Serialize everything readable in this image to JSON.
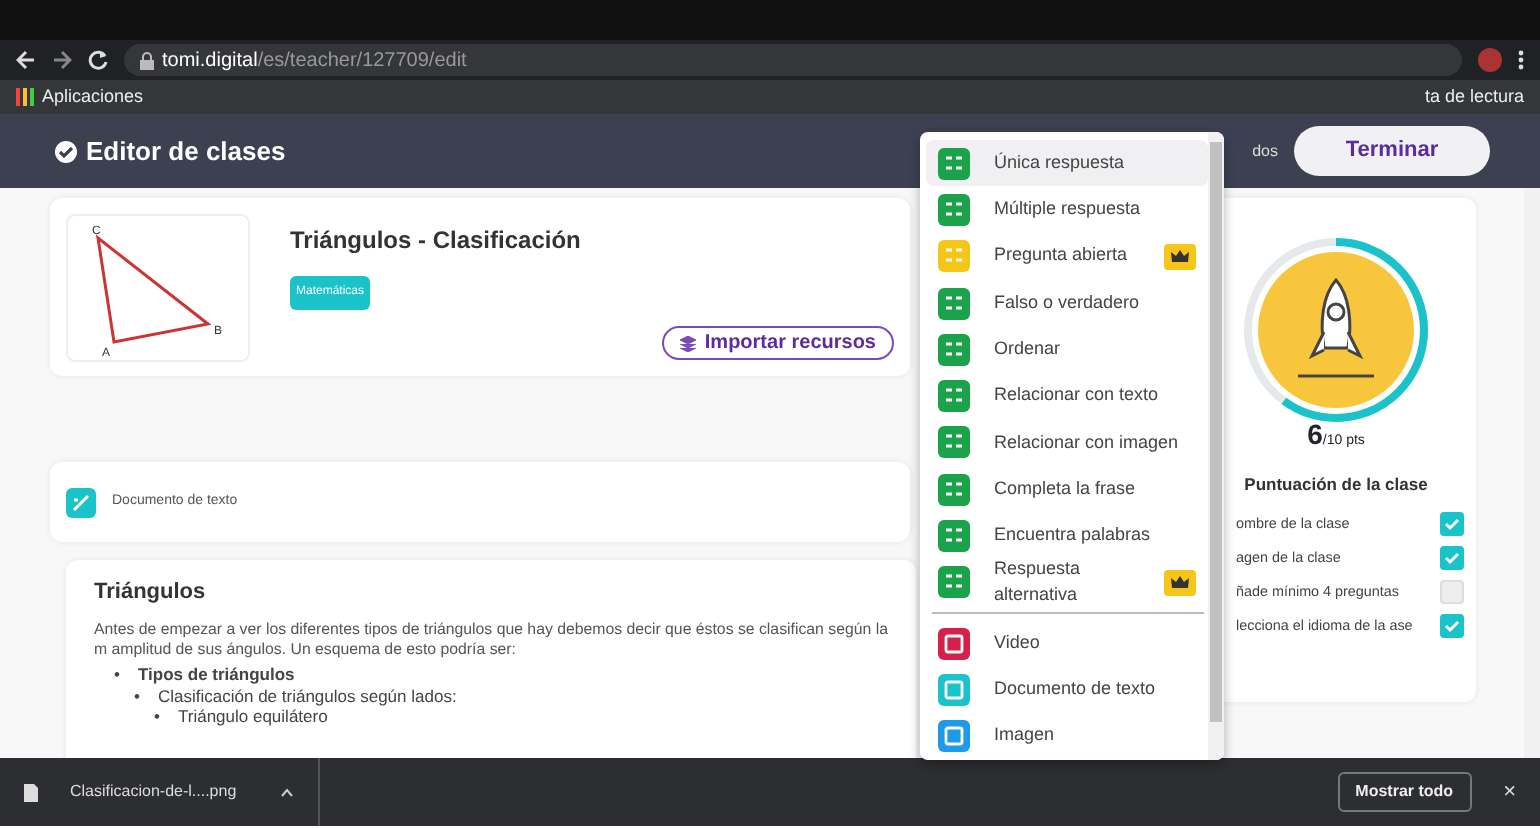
{
  "browser": {
    "url_host": "tomi.digital",
    "url_path": "/es/teacher/127709/edit",
    "bookmarks": [
      "Aplicaciones"
    ],
    "reading_list": "ta de lectura"
  },
  "header": {
    "title": "Editor de clases",
    "hidden_label": "dos",
    "finish_button": "Terminar"
  },
  "lesson": {
    "title": "Triángulos - Clasificación",
    "tag": "Matemáticas",
    "import_button": "Importar recursos",
    "vertices": [
      "C",
      "B",
      "A"
    ]
  },
  "document_block": {
    "label": "Documento de texto",
    "heading": "Triángulos",
    "paragraph": "Antes de empezar a ver los diferentes tipos de triángulos que hay debemos decir que éstos se clasifican según la m amplitud de sus ángulos. Un esquema de esto podría ser:",
    "outline": [
      {
        "bullet": "•",
        "text": "Tipos de triángulos",
        "children": [
          {
            "bullet": "•",
            "text": "Clasificación de triángulos según lados:",
            "children": [
              {
                "bullet": "•",
                "text": "Triángulo equilátero"
              }
            ]
          }
        ]
      }
    ]
  },
  "score_card": {
    "level": 0.6,
    "score": "6",
    "max": "/10 pts",
    "title": "Puntuación de la clase",
    "checklist": [
      {
        "label": "ombre de la clase",
        "checked": true
      },
      {
        "label": "agen de la clase",
        "checked": true
      },
      {
        "label": "ñade mínimo 4 preguntas",
        "checked": false
      },
      {
        "label": "lecciona el idioma de la ase",
        "checked": true
      }
    ]
  },
  "add_menu": {
    "items": [
      {
        "label": "Única respuesta",
        "color": "#1aa34a",
        "premium": false,
        "selected": true,
        "kind": "question"
      },
      {
        "label": "Múltiple respuesta",
        "color": "#1aa34a",
        "premium": false,
        "selected": false,
        "kind": "question"
      },
      {
        "label": "Pregunta abierta",
        "color": "#f5c518",
        "premium": true,
        "selected": false,
        "kind": "question"
      },
      {
        "label": "Falso o verdadero",
        "color": "#1aa34a",
        "premium": false,
        "selected": false,
        "kind": "question"
      },
      {
        "label": "Ordenar",
        "color": "#1aa34a",
        "premium": false,
        "selected": false,
        "kind": "question"
      },
      {
        "label": "Relacionar con texto",
        "color": "#1aa34a",
        "premium": false,
        "selected": false,
        "kind": "question"
      },
      {
        "label": "Relacionar con imagen",
        "color": "#1aa34a",
        "premium": false,
        "selected": false,
        "kind": "question"
      },
      {
        "label": "Completa la frase",
        "color": "#1aa34a",
        "premium": false,
        "selected": false,
        "kind": "question"
      },
      {
        "label": "Encuentra palabras",
        "color": "#1aa34a",
        "premium": false,
        "selected": false,
        "kind": "question"
      },
      {
        "label": "Respuesta alternativa",
        "color": "#1aa34a",
        "premium": true,
        "selected": false,
        "kind": "question"
      },
      {
        "label": "Video",
        "color": "#d4204a",
        "premium": false,
        "selected": false,
        "kind": "media"
      },
      {
        "label": "Documento de texto",
        "color": "#19c3c9",
        "premium": false,
        "selected": false,
        "kind": "media"
      },
      {
        "label": "Imagen",
        "color": "#1e9be8",
        "premium": false,
        "selected": false,
        "kind": "media"
      }
    ]
  },
  "downloads": {
    "file": "Clasificacion-de-l....png",
    "show_all": "Mostrar todo",
    "close": "×"
  }
}
